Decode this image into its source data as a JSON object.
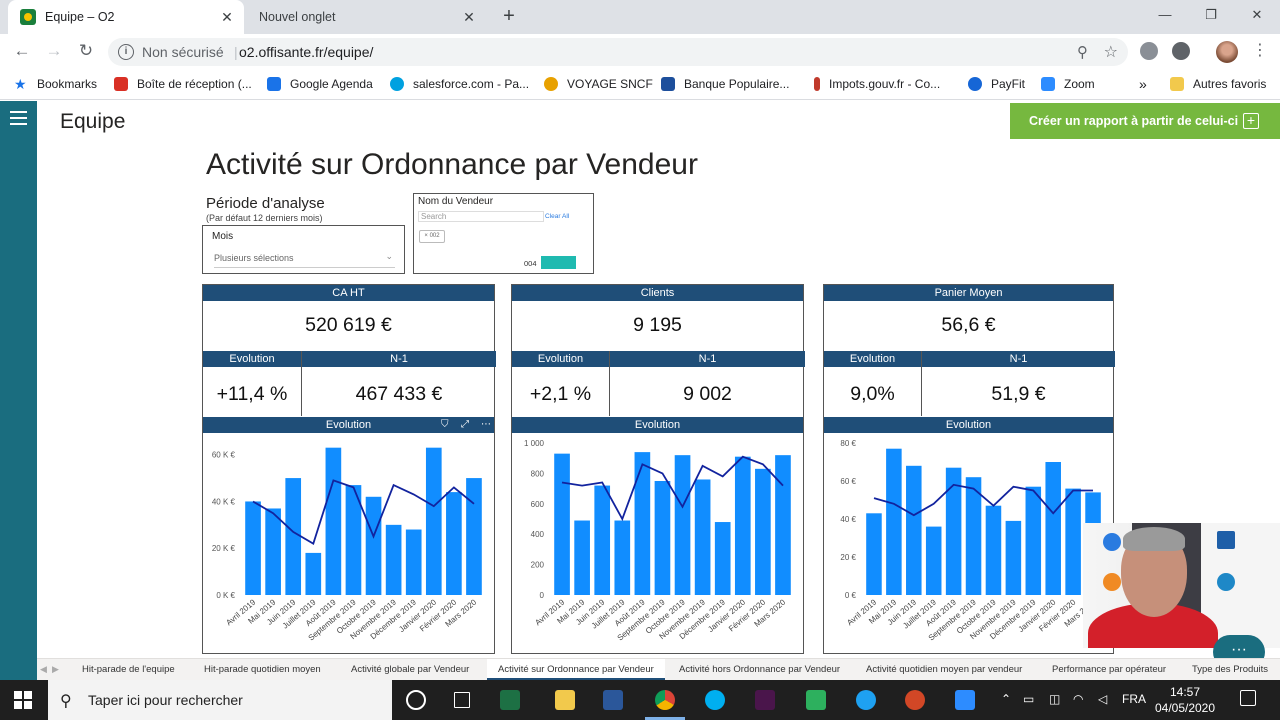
{
  "browser": {
    "tabs": [
      {
        "title": "Equipe – O2",
        "active": true
      },
      {
        "title": "Nouvel onglet",
        "active": false
      }
    ],
    "security": "Non sécurisé",
    "url": "o2.offisante.fr/equipe/",
    "bookmarks": [
      {
        "label": "Bookmarks",
        "color": "#1a73e8"
      },
      {
        "label": "Boîte de réception (...",
        "color": "#d93025"
      },
      {
        "label": "Google Agenda",
        "color": "#1a73e8"
      },
      {
        "label": "salesforce.com - Pa...",
        "color": "#00a1e0"
      },
      {
        "label": "VOYAGE SNCF",
        "color": "#e8a100"
      },
      {
        "label": "Banque Populaire...",
        "color": "#1d4f9c"
      },
      {
        "label": "Impots.gouv.fr - Co...",
        "color": "#c0392b"
      },
      {
        "label": "PayFit",
        "color": "#1666d6"
      },
      {
        "label": "Zoom",
        "color": "#2d8cff"
      },
      {
        "label": "Autres favoris",
        "color": "#f2c94c"
      }
    ],
    "more_bookmarks": "»"
  },
  "app": {
    "title": "Equipe",
    "create_report": "Créer un rapport à partir de celui-ci"
  },
  "report": {
    "title": "Activité sur Ordonnance par Vendeur",
    "periode_label": "Période d'analyse",
    "periode_sub": "(Par défaut 12 derniers mois)",
    "mois_label": "Mois",
    "mois_value": "Plusieurs sélections",
    "vendeur_label": "Nom du Vendeur",
    "vendeur_search": "Search",
    "vendeur_clear": "Clear All",
    "vendeur_chip": "× 002",
    "vendeur_value": "004",
    "kpis": [
      {
        "title": "CA HT",
        "value": "520 619 €",
        "evo_label": "Evolution",
        "evo_value": "+11,4 %",
        "n1_label": "N-1",
        "n1_value": "467 433 €",
        "chart_title": "Evolution"
      },
      {
        "title": "Clients",
        "value": "9 195",
        "evo_label": "Evolution",
        "evo_value": "+2,1 %",
        "n1_label": "N-1",
        "n1_value": "9 002",
        "chart_title": "Evolution"
      },
      {
        "title": "Panier Moyen",
        "value": "56,6 €",
        "evo_label": "Evolution",
        "evo_value": "9,0%",
        "n1_label": "N-1",
        "n1_value": "51,9 €",
        "chart_title": "Evolution"
      }
    ]
  },
  "chart_data": [
    {
      "type": "bar",
      "title": "Evolution",
      "categories": [
        "Avril 2019",
        "Mai 2019",
        "Juin 2019",
        "Juillet 2019",
        "Août 2019",
        "Septembre 2019",
        "Octobre 2019",
        "Novembre 2019",
        "Décembre 2019",
        "Janvier 2020",
        "Février 2020",
        "Mars 2020"
      ],
      "series": [
        {
          "values": [
            40000,
            37000,
            50000,
            18000,
            63000,
            47000,
            42000,
            30000,
            28000,
            63000,
            44000,
            50000
          ]
        },
        {
          "type": "line",
          "values": [
            40000,
            35000,
            27000,
            22000,
            49000,
            46000,
            25000,
            47000,
            43000,
            38000,
            46000,
            39000
          ]
        }
      ],
      "ylim": [
        0,
        65000
      ],
      "yticks": [
        "0 K €",
        "20 K €",
        "40 K €",
        "60 K €"
      ],
      "ytick_values": [
        0,
        20000,
        40000,
        60000
      ],
      "color": "#118dff",
      "line_color": "#12239e"
    },
    {
      "type": "bar",
      "title": "Evolution",
      "categories": [
        "Avril 2019",
        "Mai 2019",
        "Juin 2019",
        "Juillet 2019",
        "Août 2019",
        "Septembre 2019",
        "Octobre 2019",
        "Novembre 2019",
        "Décembre 2019",
        "Janvier 2020",
        "Février 2020",
        "Mars 2020"
      ],
      "series": [
        {
          "values": [
            930,
            490,
            720,
            490,
            940,
            750,
            920,
            760,
            480,
            910,
            830,
            920
          ]
        },
        {
          "type": "line",
          "values": [
            740,
            720,
            740,
            500,
            860,
            800,
            580,
            850,
            780,
            910,
            860,
            720
          ]
        }
      ],
      "ylim": [
        0,
        1000
      ],
      "yticks": [
        "0",
        "200",
        "400",
        "600",
        "800",
        "1 000"
      ],
      "ytick_values": [
        0,
        200,
        400,
        600,
        800,
        1000
      ],
      "color": "#118dff",
      "line_color": "#12239e"
    },
    {
      "type": "bar",
      "title": "Evolution",
      "categories": [
        "Avril 2019",
        "Mai 2019",
        "Juin 2019",
        "Juillet 2019",
        "Août 2019",
        "Septembre 2019",
        "Octobre 2019",
        "Novembre 2019",
        "Décembre 2019",
        "Janvier 2020",
        "Février 2020",
        "Mars 2020"
      ],
      "series": [
        {
          "values": [
            43,
            77,
            68,
            36,
            67,
            62,
            47,
            39,
            57,
            70,
            56,
            54
          ]
        },
        {
          "type": "line",
          "values": [
            51,
            48,
            42,
            48,
            58,
            56,
            47,
            57,
            55,
            43,
            55,
            55
          ]
        }
      ],
      "ylim": [
        0,
        80
      ],
      "yticks": [
        "0 €",
        "20 €",
        "40 €",
        "60 €",
        "80 €"
      ],
      "ytick_values": [
        0,
        20,
        40,
        60,
        80
      ],
      "color": "#118dff",
      "line_color": "#12239e"
    }
  ],
  "page_tabs": [
    {
      "label": "Hit-parade de l'equipe",
      "active": false
    },
    {
      "label": "Hit-parade quotidien moyen",
      "active": false
    },
    {
      "label": "Activité globale par Vendeur",
      "active": false
    },
    {
      "label": "Activité sur Ordonnance par Vendeur",
      "active": true
    },
    {
      "label": "Activité hors Ordonnance par Vendeur",
      "active": false
    },
    {
      "label": "Activité quotidien moyen par vendeur",
      "active": false
    },
    {
      "label": "Performance par opérateur",
      "active": false
    },
    {
      "label": "Type des Produits",
      "active": false
    }
  ],
  "taskbar": {
    "search_placeholder": "Taper ici pour rechercher",
    "lang": "FRA",
    "time": "14:57",
    "date": "04/05/2020"
  }
}
